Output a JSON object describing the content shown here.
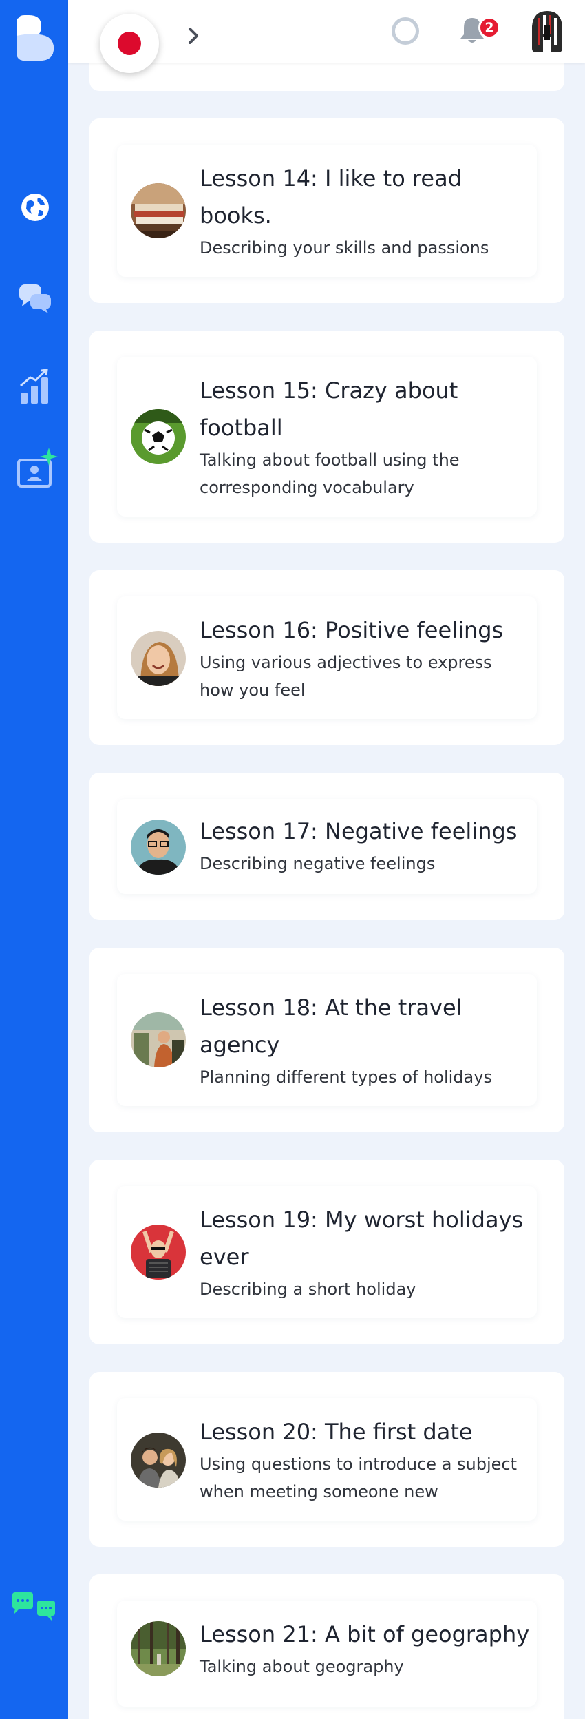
{
  "header": {
    "notification_count": "2"
  },
  "lessons": [
    {
      "title": "Lesson 14: I like to read books.",
      "description": "Describing your skills and passions",
      "thumb_icon": "books-thumbnail"
    },
    {
      "title": "Lesson 15: Crazy about football",
      "description": "Talking about football using the corresponding vocabulary",
      "thumb_icon": "football-thumbnail"
    },
    {
      "title": "Lesson 16: Positive feelings",
      "description": "Using various adjectives to express how you feel",
      "thumb_icon": "smiling-woman-thumbnail"
    },
    {
      "title": "Lesson 17: Negative feelings",
      "description": "Describing negative feelings",
      "thumb_icon": "man-glasses-thumbnail"
    },
    {
      "title": "Lesson 18: At the travel agency",
      "description": "Planning different types of holidays",
      "thumb_icon": "travel-agency-thumbnail"
    },
    {
      "title": "Lesson 19: My worst holidays ever",
      "description": "Describing a short holiday",
      "thumb_icon": "holiday-woman-thumbnail"
    },
    {
      "title": "Lesson 20: The first date",
      "description": "Using questions to introduce a subject when meeting someone new",
      "thumb_icon": "couple-thumbnail"
    },
    {
      "title": "Lesson 21: A bit of geography",
      "description": "Talking about geography",
      "thumb_icon": "forest-thumbnail"
    }
  ],
  "colors": {
    "sidebar": "#1466f0",
    "background": "#eef3fb",
    "badge": "#e51c32",
    "flag": "#dc0a2d",
    "accent_green": "#2ee59d"
  }
}
